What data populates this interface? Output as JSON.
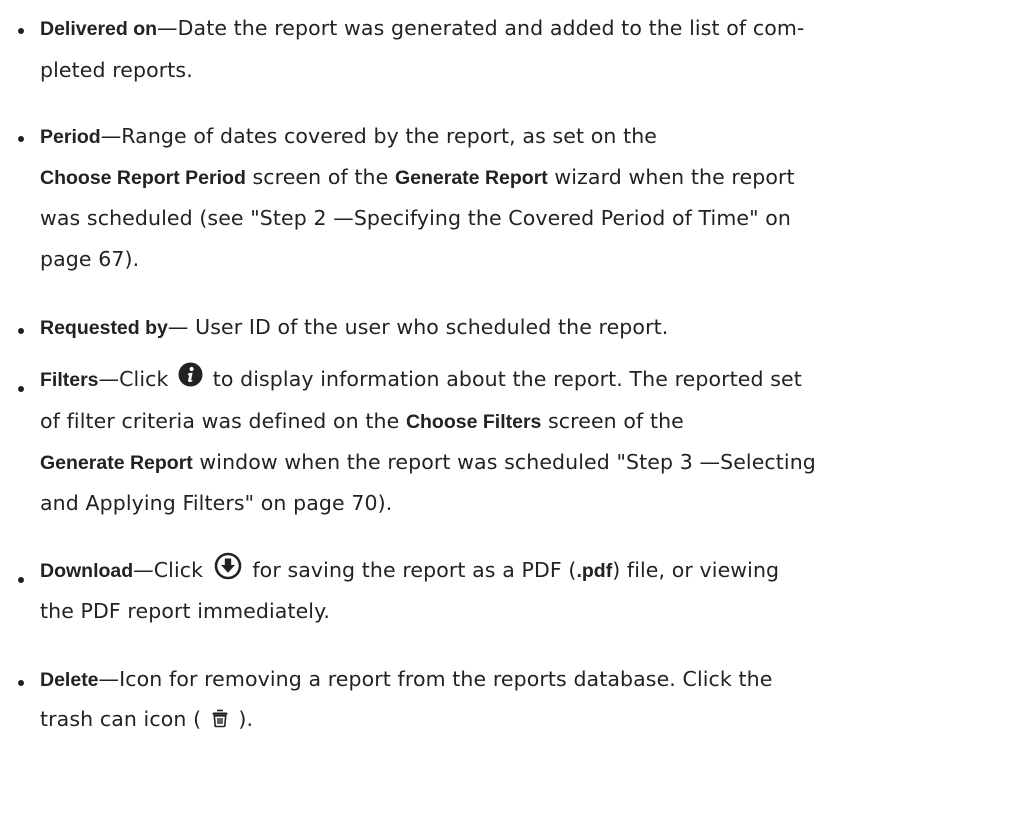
{
  "items": [
    {
      "term": "Delivered on",
      "lines": [
        "—Date the report was generated and added to the list of com-",
        "pleted reports."
      ]
    },
    {
      "term": "Period",
      "line1": "—Range of dates covered by the report, as set on the",
      "line2_bold_a": "Choose Report Period",
      "line2_mid": " screen of the ",
      "line2_bold_b": "Generate Report",
      "line2_end": " wizard when the report",
      "line3": "was scheduled (see \"Step 2 —Specifying the Covered Period of Time\" on",
      "line4": "page 67)."
    },
    {
      "term": "Requested by",
      "line1": "— User ID of the user who scheduled the report."
    },
    {
      "term": "Filters",
      "line1_a": "—Click ",
      "icon": "info-circle-icon",
      "line1_b": " to display information about the report. The reported set",
      "line2_a": "of filter criteria was defined on the ",
      "line2_bold": "Choose Filters",
      "line2_b": " screen of the",
      "line3_bold": "Generate Report",
      "line3_rest": " window when the report was scheduled \"Step 3 —Selecting",
      "line4": "and Applying Filters\" on page 70)."
    },
    {
      "term": "Download",
      "line1_a": "—Click ",
      "icon": "download-circle-icon",
      "line1_b": " for saving the report as a PDF (",
      "line1_bold": ".pdf",
      "line1_c": ") file, or viewing",
      "line2": "the PDF report immediately."
    },
    {
      "term": "Delete",
      "line1": "—Icon for removing a report from the reports database. Click the",
      "line2_a": "trash can icon ( ",
      "icon": "trash-can-icon",
      "line2_b": " )."
    }
  ],
  "colors": {
    "text": "#222222",
    "icon": "#222222",
    "background": "#ffffff"
  }
}
